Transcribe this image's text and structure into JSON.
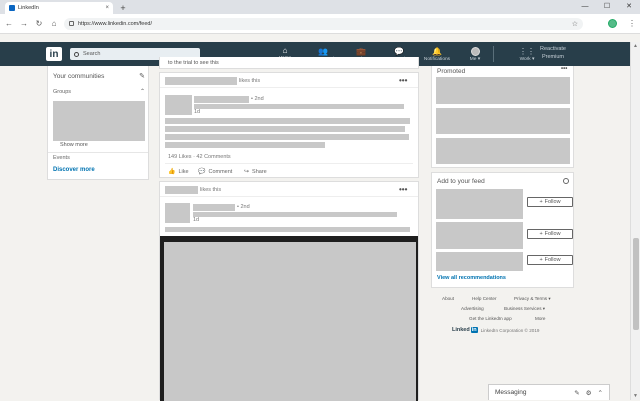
{
  "browser": {
    "tab_title": "LinkedIn",
    "tab_close": "×",
    "new_tab": "+",
    "url": "https://www.linkedin.com/feed/",
    "win_min": "—",
    "win_max": "☐",
    "win_close": "✕",
    "back": "←",
    "forward": "→",
    "reload": "↻",
    "home": "⌂",
    "star": "☆",
    "menu": "⋮"
  },
  "linkedin_nav": {
    "logo": "in",
    "search_placeholder": "Search",
    "items": [
      {
        "label": "Home",
        "icon": "⌂"
      },
      {
        "label": "My Network",
        "icon": "👥"
      },
      {
        "label": "Jobs",
        "icon": "💼"
      },
      {
        "label": "Messaging",
        "icon": "💬"
      },
      {
        "label": "Notifications",
        "icon": "🔔"
      },
      {
        "label": "Me ▾",
        "icon": ""
      },
      {
        "label": "Work ▾",
        "icon": "⋮⋮"
      }
    ],
    "premium_line1": "Reactivate",
    "premium_line2": "Premium"
  },
  "left_rail": {
    "communities_title": "Your communities",
    "groups_label": "Groups",
    "show_more": "Show more",
    "events_label": "Events",
    "discover": "Discover more"
  },
  "feed": {
    "top_snippet": "to the trial to see this",
    "post1": {
      "header_suffix": "likes this",
      "degree": "• 2nd",
      "time": "1d",
      "stats": "149 Likes · 42 Comments",
      "actions": [
        {
          "label": "Like",
          "icon": "👍"
        },
        {
          "label": "Comment",
          "icon": "💬"
        },
        {
          "label": "Share",
          "icon": "↪"
        }
      ]
    },
    "post2": {
      "header_suffix": "likes this",
      "degree": "• 2nd",
      "time": "1d"
    },
    "more": "•••"
  },
  "right_rail": {
    "promoted_title": "Promoted",
    "add_feed_title": "Add to your feed",
    "follow_label": "Follow",
    "follow_plus": "+",
    "view_all": "View all recommendations",
    "footer": {
      "row1": [
        "About",
        "Help Center",
        "Privacy & Terms ▾"
      ],
      "row2": [
        "Advertising",
        "Business Services ▾"
      ],
      "row3": [
        "Get the LinkedIn app",
        "More"
      ],
      "logo_text": "Linked",
      "logo_in": "in",
      "copyright": "LinkedIn Corporation © 2019"
    }
  },
  "messaging": {
    "label": "Messaging",
    "icon1": "✎",
    "icon2": "⚙",
    "icon3": "⌃"
  }
}
